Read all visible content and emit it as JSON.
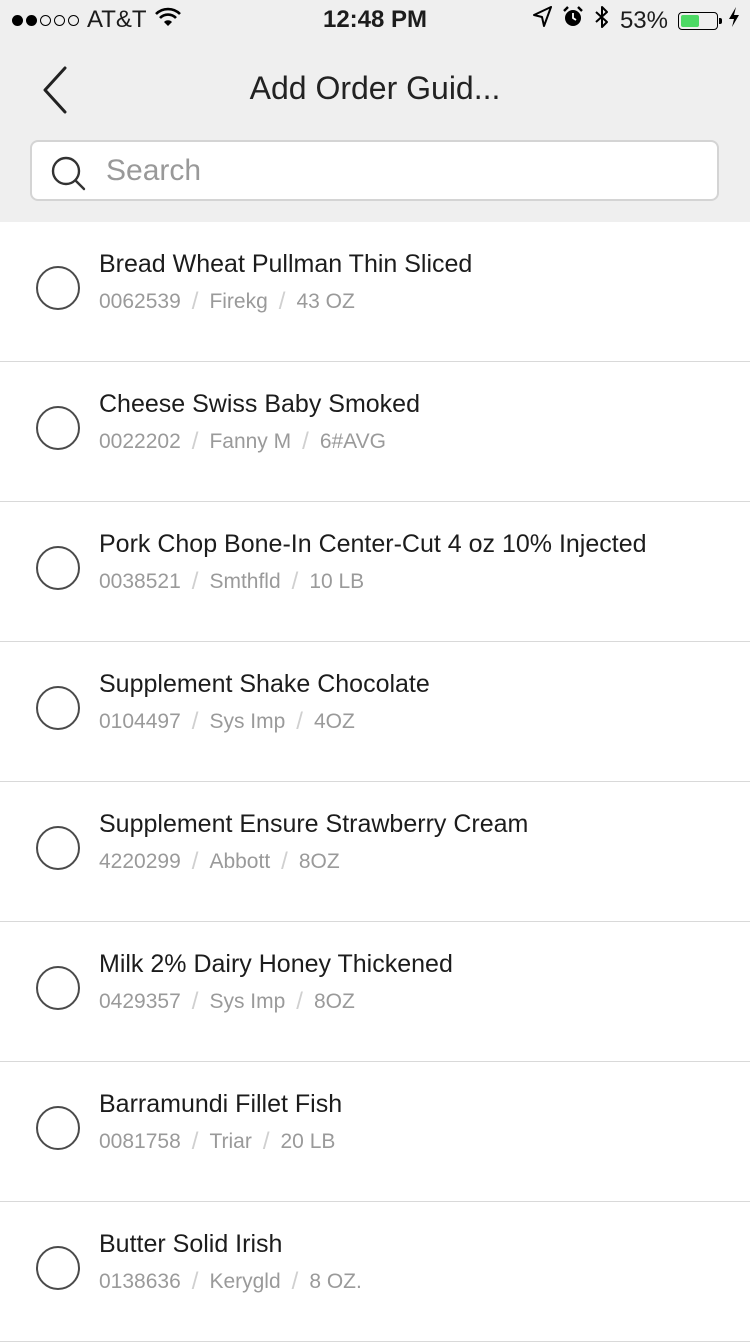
{
  "status_bar": {
    "carrier": "AT&T",
    "time": "12:48 PM",
    "battery_percent": "53%",
    "battery_level": 0.53,
    "signal_bars_filled": 2,
    "signal_bars_total": 5,
    "icons": [
      "wifi-icon",
      "location-icon",
      "alarm-icon",
      "bluetooth-icon",
      "charging-icon"
    ]
  },
  "nav": {
    "title": "Add Order Guid...",
    "back_icon": "chevron-left-icon"
  },
  "search": {
    "placeholder": "Search",
    "value": ""
  },
  "items": [
    {
      "name": "Bread Wheat Pullman Thin Sliced",
      "code": "0062539",
      "brand": "Firekg",
      "pack": "43 OZ"
    },
    {
      "name": "Cheese Swiss Baby Smoked",
      "code": "0022202",
      "brand": "Fanny M",
      "pack": "6#AVG"
    },
    {
      "name": "Pork Chop Bone-In Center-Cut 4 oz 10% Injected",
      "code": "0038521",
      "brand": "Smthfld",
      "pack": "10 LB"
    },
    {
      "name": "Supplement Shake Chocolate",
      "code": "0104497",
      "brand": "Sys Imp",
      "pack": "4OZ"
    },
    {
      "name": "Supplement Ensure Strawberry Cream",
      "code": "4220299",
      "brand": "Abbott",
      "pack": "8OZ"
    },
    {
      "name": "Milk 2% Dairy Honey Thickened",
      "code": "0429357",
      "brand": "Sys Imp",
      "pack": "8OZ"
    },
    {
      "name": "Barramundi Fillet Fish",
      "code": "0081758",
      "brand": "Triar",
      "pack": "20 LB"
    },
    {
      "name": "Butter Solid Irish",
      "code": "0138636",
      "brand": "Kerygld",
      "pack": "8 OZ."
    }
  ],
  "colors": {
    "header_bg": "#efefef",
    "battery_green": "#4cd964",
    "meta_text": "#9a9a9a"
  }
}
